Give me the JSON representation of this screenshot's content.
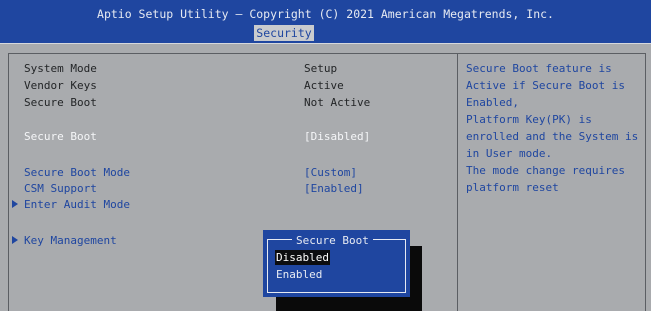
{
  "header": {
    "title": "Aptio Setup Utility – Copyright (C) 2021 American Megatrends, Inc.",
    "active_tab": "Security"
  },
  "settings": [
    {
      "label": "System Mode",
      "value": "Setup"
    },
    {
      "label": "Vendor Keys",
      "value": "Active"
    },
    {
      "label": "Secure Boot",
      "value": "Not Active"
    },
    {
      "label": "Secure Boot",
      "value": "[Disabled]"
    },
    {
      "label": "Secure Boot Mode",
      "value": "[Custom]"
    },
    {
      "label": "CSM Support",
      "value": "[Enabled]"
    },
    {
      "label": "Enter Audit Mode"
    },
    {
      "label": "Key Management"
    }
  ],
  "help_lines": [
    "Secure Boot feature is",
    "Active if Secure Boot is",
    "Enabled,",
    "Platform Key(PK) is",
    "enrolled and the System is",
    "in User mode.",
    "The mode change requires",
    "platform reset"
  ],
  "popup": {
    "title": "Secure Boot",
    "options": [
      "Disabled",
      "Enabled"
    ],
    "selected_index": 0
  },
  "colors": {
    "header_blue": "#1f46a0",
    "panel_gray": "#a9abae",
    "text_dark": "#232527",
    "highlight_white": "#f5f6f8"
  }
}
